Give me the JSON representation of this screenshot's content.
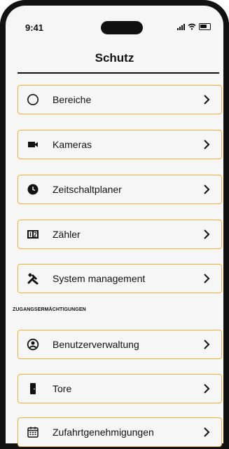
{
  "status_bar": {
    "time": "9:41"
  },
  "header": {
    "title": "Schutz"
  },
  "menu": {
    "items": [
      {
        "label": "Bereiche",
        "icon": "circle-outline-icon"
      },
      {
        "label": "Kameras",
        "icon": "camera-icon"
      },
      {
        "label": "Zeitschaltplaner",
        "icon": "clock-icon"
      },
      {
        "label": "Zähler",
        "icon": "counter-icon"
      },
      {
        "label": "System management",
        "icon": "tools-icon"
      }
    ]
  },
  "section": {
    "title": "ZUGANGSERMÄCHTIGUNGEN",
    "items": [
      {
        "label": "Benutzerverwaltung",
        "icon": "user-circle-icon"
      },
      {
        "label": "Tore",
        "icon": "door-icon"
      },
      {
        "label": "Zufahrtgenehmigungen",
        "icon": "calendar-icon"
      }
    ]
  },
  "colors": {
    "accent_border": "#f3b13b",
    "background": "#f6f6f6",
    "text": "#111111"
  }
}
